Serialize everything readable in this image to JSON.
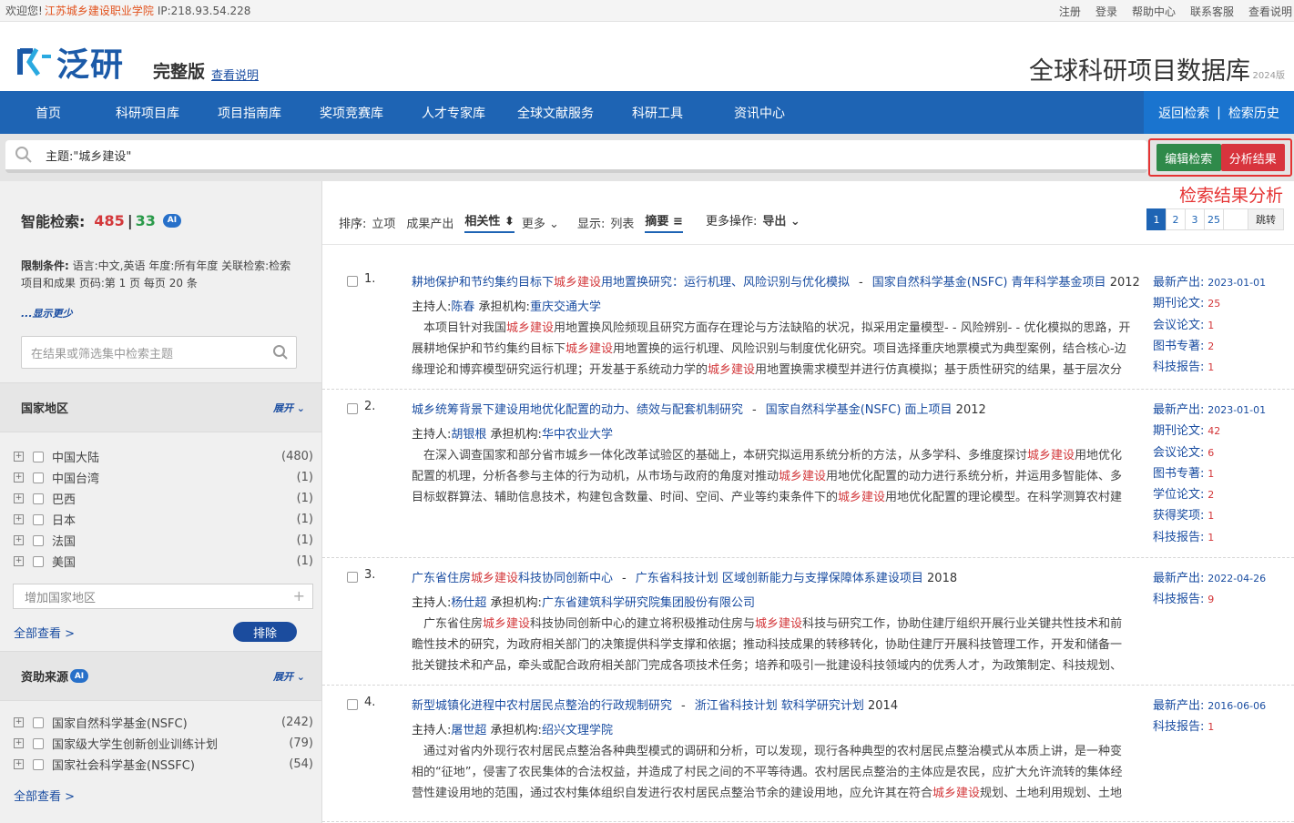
{
  "topbar": {
    "welcome": "欢迎您!",
    "institution": "江苏城乡建设职业学院",
    "ip": "IP:218.93.54.228",
    "links": [
      "注册",
      "登录",
      "帮助中心",
      "联系客服",
      "查看说明"
    ]
  },
  "header": {
    "logo_text": "泛研",
    "edition": "完整版",
    "edition_link": "查看说明",
    "db_title": "全球科研项目数据库",
    "db_year": "2024版"
  },
  "nav": {
    "items": [
      "首页",
      "科研项目库",
      "项目指南库",
      "奖项竞赛库",
      "人才专家库",
      "全球文献服务",
      "科研工具",
      "资讯中心"
    ],
    "back": "返回检索",
    "sep": "|",
    "history": "检索历史"
  },
  "search": {
    "query": "主题:\"城乡建设\"",
    "edit_label": "编辑检索",
    "analyze_label": "分析结果",
    "annotation": "检索结果分析"
  },
  "sidebar": {
    "smart_label": "智能检索:",
    "count_total": "485",
    "count_sep": "|",
    "count_ai": "33",
    "ai_badge": "AI",
    "limits_label": "限制条件:",
    "limits_text": "语言:中文,英语 年度:所有年度 关联检索:检索项目和成果 页码:第 1 页 每页 20 条",
    "show_less": "...显示更少",
    "filter_placeholder": "在结果或筛选集中检索主题",
    "region": {
      "title": "国家地区",
      "expand": "展开",
      "items": [
        {
          "label": "中国大陆",
          "count": "(480)"
        },
        {
          "label": "中国台湾",
          "count": "(1)"
        },
        {
          "label": "巴西",
          "count": "(1)"
        },
        {
          "label": "日本",
          "count": "(1)"
        },
        {
          "label": "法国",
          "count": "(1)"
        },
        {
          "label": "美国",
          "count": "(1)"
        }
      ],
      "add_placeholder": "增加国家地区",
      "view_all": "全部查看 >",
      "exclude": "排除"
    },
    "funding": {
      "title": "资助来源",
      "ai_badge": "AI",
      "expand": "展开",
      "items": [
        {
          "label": "国家自然科学基金(NSFC)",
          "count": "(242)"
        },
        {
          "label": "国家级大学生创新创业训练计划",
          "count": "(79)"
        },
        {
          "label": "国家社会科学基金(NSSFC)",
          "count": "(54)"
        }
      ],
      "view_all": "全部查看 >"
    }
  },
  "toolbar": {
    "sort_label": "排序:",
    "sort_opts": [
      "立项",
      "成果产出",
      "相关性",
      "更多"
    ],
    "display_label": "显示:",
    "display_opts": [
      "列表",
      "摘要"
    ],
    "more_ops_label": "更多操作:",
    "export": "导出",
    "pages": [
      "1",
      "2",
      "3",
      "25"
    ],
    "goto": "跳转"
  },
  "results": [
    {
      "num": "1.",
      "title_pre": "耕地保护和节约集约目标下",
      "title_hl": "城乡建设",
      "title_post": "用地置换研究：运行机理、风险识别与优化模拟",
      "dash": "-",
      "program": "国家自然科学基金(NSFC) 青年科学基金项目",
      "year": "2012",
      "pi_label": "主持人:",
      "pi": "陈春",
      "org_label": "承担机构:",
      "org": "重庆交通大学",
      "abstract": "本项目针对我国<span class=\"hl\">城乡建设</span>用地置换风险频现且研究方面存在理论与方法缺陷的状况，拟采用定量模型- - 风险辨别- - 优化模拟的思路，开展耕地保护和节约集约目标下<span class=\"hl\">城乡建设</span>用地置换的运行机理、风险识别与制度优化研究。项目选择重庆地票模式为典型案例，结合核心-边缘理论和博弈模型研究运行机理；开发基于系统动力学的<span class=\"hl\">城乡建设</span>用地置换需求模型并进行仿真模拟；基于质性研究的结果，基于层次分析法和风险...",
      "stats": [
        {
          "k": "最新产出:",
          "v": "2023-01-01",
          "date": true
        },
        {
          "k": "期刊论文:",
          "v": "25"
        },
        {
          "k": "会议论文:",
          "v": "1"
        },
        {
          "k": "图书专著:",
          "v": "2"
        },
        {
          "k": "科技报告:",
          "v": "1"
        }
      ]
    },
    {
      "num": "2.",
      "title_pre": "城乡统筹背景下建设用地优化配置的动力、绩效与配套机制研究",
      "title_hl": "",
      "title_post": "",
      "dash": "-",
      "program": "国家自然科学基金(NSFC) 面上项目",
      "year": "2012",
      "pi_label": "主持人:",
      "pi": "胡银根",
      "org_label": "承担机构:",
      "org": "华中农业大学",
      "abstract": "在深入调查国家和部分省市城乡一体化改革试验区的基础上，本研究拟运用系统分析的方法，从多学科、多维度探讨<span class=\"hl\">城乡建设</span>用地优化配置的机理，分析各参与主体的行为动机，从市场与政府的角度对推动<span class=\"hl\">城乡建设</span>用地优化配置的动力进行系统分析，并运用多智能体、多目标蚁群算法、辅助信息技术，构建包含数量、时间、空间、产业等约束条件下的<span class=\"hl\">城乡建设</span>用地优化配置的理论模型。在科学测算农村建设用地（主要...",
      "stats": [
        {
          "k": "最新产出:",
          "v": "2023-01-01",
          "date": true
        },
        {
          "k": "期刊论文:",
          "v": "42"
        },
        {
          "k": "会议论文:",
          "v": "6"
        },
        {
          "k": "图书专著:",
          "v": "1"
        },
        {
          "k": "学位论文:",
          "v": "2"
        },
        {
          "k": "获得奖项:",
          "v": "1"
        },
        {
          "k": "科技报告:",
          "v": "1"
        }
      ]
    },
    {
      "num": "3.",
      "title_pre": "广东省住房",
      "title_hl": "城乡建设",
      "title_post": "科技协同创新中心",
      "dash": "-",
      "program": "广东省科技计划 区域创新能力与支撑保障体系建设项目",
      "year": "2018",
      "pi_label": "主持人:",
      "pi": "杨仕超",
      "org_label": "承担机构:",
      "org": "广东省建筑科学研究院集团股份有限公司",
      "abstract": "广东省住房<span class=\"hl\">城乡建设</span>科技协同创新中心的建立将积极推动住房与<span class=\"hl\">城乡建设</span>科技与研究工作，协助住建厅组织开展行业关键共性技术和前瞻性技术的研究，为政府相关部门的决策提供科学支撑和依据；推动科技成果的转移转化，协助住建厅开展科技管理工作，开发和储备一批关键技术和产品，牵头或配合政府相关部门完成各项技术任务；培养和吸引一批建设科技领域内的优秀人才，为政策制定、科技规划、行业发展、中...",
      "stats": [
        {
          "k": "最新产出:",
          "v": "2022-04-26",
          "date": true
        },
        {
          "k": "科技报告:",
          "v": "9"
        }
      ]
    },
    {
      "num": "4.",
      "title_pre": "新型城镇化进程中农村居民点整治的行政规制研究",
      "title_hl": "",
      "title_post": "",
      "dash": "-",
      "program": "浙江省科技计划 软科学研究计划",
      "year": "2014",
      "pi_label": "主持人:",
      "pi": "屠世超",
      "org_label": "承担机构:",
      "org": "绍兴文理学院",
      "abstract": "通过对省内外现行农村居民点整治各种典型模式的调研和分析，可以发现，现行各种典型的农村居民点整治模式从本质上讲，是一种变相的“征地”，侵害了农民集体的合法权益，并造成了村民之间的不平等待遇。农村居民点整治的主体应是农民，应扩大允许流转的集体经营性建设用地的范围，通过农村集体组织自发进行农村居民点整治节余的建设用地，应允许其在符合<span class=\"hl\">城乡建设</span>规划、土地利用规划、土地用途管制等...",
      "stats": [
        {
          "k": "最新产出:",
          "v": "2016-06-06",
          "date": true
        },
        {
          "k": "科技报告:",
          "v": "1"
        }
      ]
    }
  ]
}
